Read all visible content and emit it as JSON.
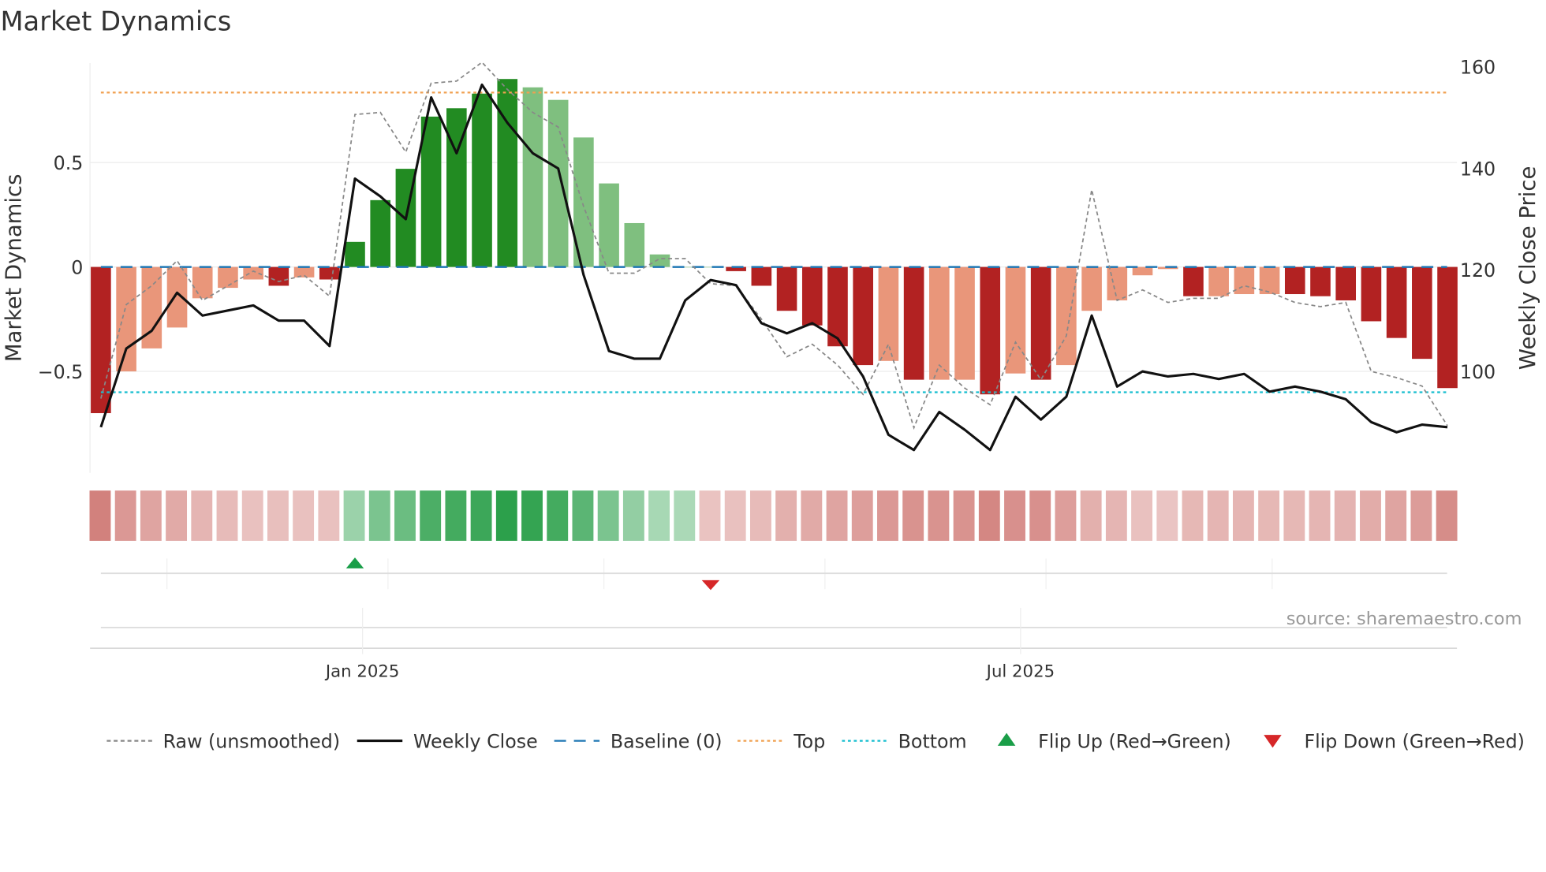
{
  "chart_data": {
    "type": "bar",
    "title": "Market Dynamics",
    "ylabel": "Market Dynamics",
    "y2label": "Weekly Close Price",
    "ylim": [
      -0.98,
      0.98
    ],
    "y2lim": [
      80,
      163
    ],
    "yticks": [
      {
        "v": 0.5,
        "label": "0.5"
      },
      {
        "v": 0,
        "label": "0"
      },
      {
        "v": -0.5,
        "label": "−0.5"
      }
    ],
    "y2ticks": [
      {
        "v": 160,
        "label": "160"
      },
      {
        "v": 140,
        "label": "140"
      },
      {
        "v": 120,
        "label": "120"
      },
      {
        "v": 100,
        "label": "100"
      }
    ],
    "xticks": [
      {
        "week": 11.3,
        "label": "Jan 2025"
      },
      {
        "week": 37.2,
        "label": "Jul 2025"
      }
    ],
    "minor_xticks_weeks": [
      2.6,
      11.3,
      19.8,
      28.5,
      37.2,
      46.1
    ],
    "top_level": 0.835,
    "bottom_level": -0.6,
    "baseline": 0,
    "dynamics": [
      -0.7,
      -0.5,
      -0.39,
      -0.29,
      -0.15,
      -0.1,
      -0.06,
      -0.09,
      -0.05,
      -0.06,
      0.12,
      0.32,
      0.47,
      0.72,
      0.76,
      0.83,
      0.9,
      0.86,
      0.8,
      0.62,
      0.4,
      0.21,
      0.06,
      0.0,
      0.0,
      -0.02,
      -0.09,
      -0.21,
      -0.28,
      -0.38,
      -0.47,
      -0.45,
      -0.54,
      -0.54,
      -0.54,
      -0.61,
      -0.51,
      -0.54,
      -0.47,
      -0.21,
      -0.16,
      -0.04,
      -0.01,
      -0.14,
      -0.14,
      -0.13,
      -0.13,
      -0.13,
      -0.14,
      -0.16,
      -0.26,
      -0.34,
      -0.44,
      -0.58
    ],
    "bar_strength": [
      "strong",
      "weak",
      "weak",
      "weak",
      "weak",
      "weak",
      "weak",
      "strong",
      "weak",
      "strong",
      "strong",
      "strong",
      "strong",
      "strong",
      "strong",
      "strong",
      "strong",
      "weak",
      "weak",
      "weak",
      "weak",
      "weak",
      "weak",
      "weak",
      "weak",
      "strong",
      "strong",
      "strong",
      "strong",
      "strong",
      "strong",
      "weak",
      "strong",
      "weak",
      "weak",
      "strong",
      "weak",
      "strong",
      "weak",
      "weak",
      "weak",
      "weak",
      "weak",
      "strong",
      "weak",
      "weak",
      "weak",
      "strong",
      "strong",
      "strong",
      "strong",
      "strong",
      "strong",
      "strong"
    ],
    "raw": [
      -0.63,
      -0.18,
      -0.09,
      0.03,
      -0.16,
      -0.09,
      -0.02,
      -0.07,
      -0.04,
      -0.14,
      0.73,
      0.74,
      0.55,
      0.88,
      0.89,
      0.98,
      0.85,
      0.74,
      0.67,
      0.29,
      -0.03,
      -0.03,
      0.04,
      0.04,
      -0.08,
      -0.09,
      -0.25,
      -0.43,
      -0.37,
      -0.47,
      -0.61,
      -0.37,
      -0.77,
      -0.47,
      -0.58,
      -0.66,
      -0.36,
      -0.54,
      -0.33,
      0.37,
      -0.16,
      -0.11,
      -0.17,
      -0.15,
      -0.15,
      -0.09,
      -0.12,
      -0.17,
      -0.19,
      -0.17,
      -0.5,
      -0.53,
      -0.57,
      -0.76
    ],
    "weekly_close": [
      89,
      104.5,
      108,
      115.5,
      111,
      112,
      113,
      110,
      110,
      105,
      138,
      134.5,
      130,
      154,
      143,
      156.5,
      149,
      143,
      140,
      119,
      104,
      102.5,
      102.5,
      114,
      118,
      117,
      109.5,
      107.5,
      109.5,
      106.5,
      99,
      87.5,
      84.5,
      92,
      88.5,
      84.5,
      95,
      90.5,
      95,
      111,
      97,
      100,
      99,
      99.5,
      98.5,
      99.5,
      96,
      97,
      96,
      94.5,
      90,
      88,
      89.5,
      89
    ],
    "strip_intensity": [
      -0.75,
      -0.55,
      -0.45,
      -0.4,
      -0.3,
      -0.25,
      -0.2,
      -0.22,
      -0.2,
      -0.2,
      0.3,
      0.5,
      0.6,
      0.8,
      0.85,
      0.9,
      1,
      0.95,
      0.85,
      0.7,
      0.5,
      0.35,
      0.22,
      0.2,
      -0.18,
      -0.2,
      -0.25,
      -0.35,
      -0.4,
      -0.45,
      -0.5,
      -0.55,
      -0.6,
      -0.6,
      -0.6,
      -0.7,
      -0.62,
      -0.62,
      -0.5,
      -0.35,
      -0.3,
      -0.2,
      -0.17,
      -0.28,
      -0.3,
      -0.3,
      -0.28,
      -0.28,
      -0.3,
      -0.32,
      -0.38,
      -0.45,
      -0.52,
      -0.65
    ],
    "flips": [
      {
        "week": 11,
        "dir": "up"
      },
      {
        "week": 25,
        "dir": "down"
      }
    ],
    "colors": {
      "strong_red": "#b22222",
      "weak_red": "#e9967a",
      "strong_green": "#228b22",
      "weak_green": "#7fbf7f",
      "close": "#111111",
      "raw": "#888888",
      "baseline": "#1f77b4",
      "top": "#f0a050",
      "bottom": "#17becf",
      "flip_up": "#1a9e48",
      "flip_down": "#d62728"
    },
    "legend": [
      {
        "key": "raw",
        "label": "Raw (unsmoothed)"
      },
      {
        "key": "close",
        "label": "Weekly Close"
      },
      {
        "key": "baseline",
        "label": "Baseline (0)"
      },
      {
        "key": "top",
        "label": "Top"
      },
      {
        "key": "bottom",
        "label": "Bottom"
      },
      {
        "key": "flip_up",
        "label": "Flip Up (Red→Green)"
      },
      {
        "key": "flip_down",
        "label": "Flip Down (Green→Red)"
      }
    ],
    "legend_placement": "bottom",
    "source": "source: sharemaestro.com"
  }
}
